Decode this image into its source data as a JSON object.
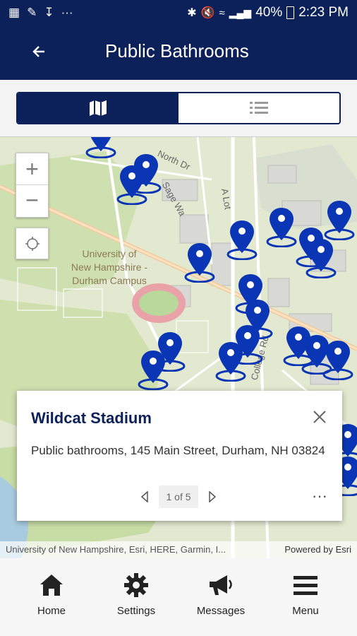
{
  "status_bar": {
    "battery": "40%",
    "time": "2:23 PM"
  },
  "header": {
    "title": "Public Bathrooms"
  },
  "view_toggle": {
    "map_icon": "map-icon",
    "list_icon": "list-icon",
    "selected": "map"
  },
  "map": {
    "labels": [
      "University of",
      "New Hampshire -",
      "Durham Campus",
      "North Dr",
      "Sage Wa",
      "A Lot",
      "College Rd"
    ],
    "attribution": "University of New Hampshire, Esri, HERE, Garmin, I...",
    "powered_by": "Powered by Esri"
  },
  "popup": {
    "title": "Wildcat Stadium",
    "description": "Public bathrooms, 145 Main Street, Durham, NH 03824",
    "page": "1 of 5"
  },
  "tabs": [
    {
      "label": "Home",
      "icon": "home-icon"
    },
    {
      "label": "Settings",
      "icon": "gear-icon"
    },
    {
      "label": "Messages",
      "icon": "megaphone-icon"
    },
    {
      "label": "Menu",
      "icon": "menu-icon"
    }
  ],
  "colors": {
    "navy": "#0c2159",
    "pin": "#0a36b5"
  }
}
